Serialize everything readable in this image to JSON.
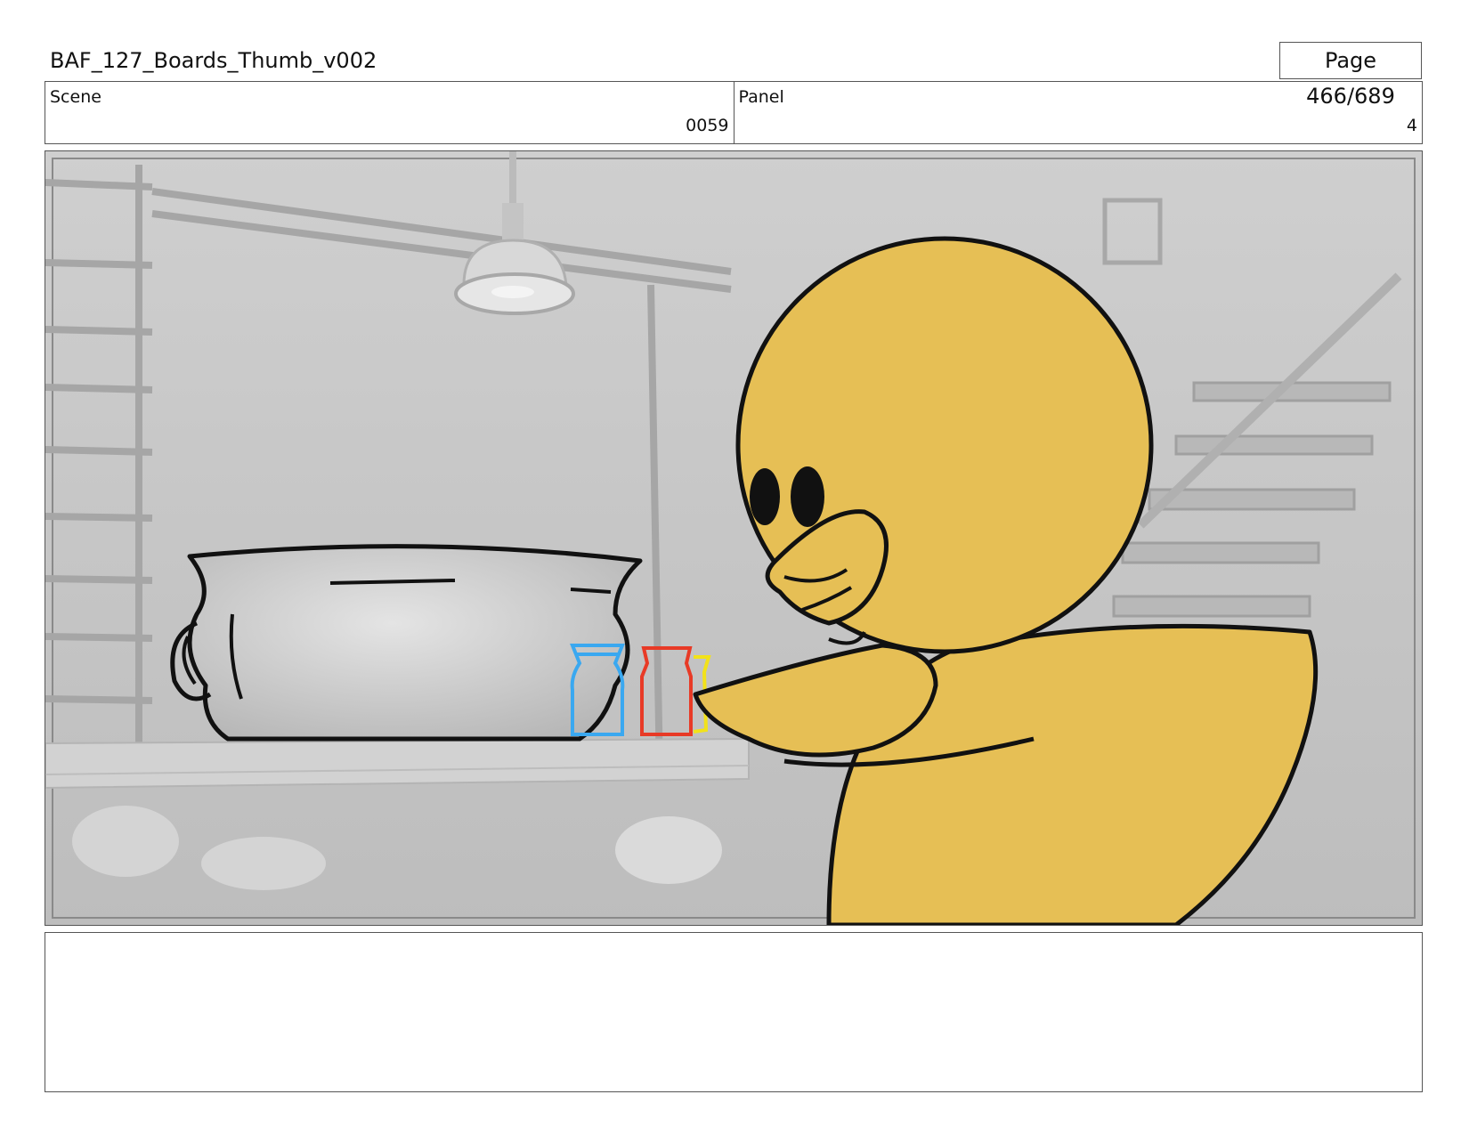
{
  "header": {
    "title": "BAF_127_Boards_Thumb_v002",
    "page": "Page 466/689"
  },
  "info": {
    "scene_label": "Scene",
    "scene_value": "0059",
    "panel_label": "Panel",
    "panel_value": "4"
  },
  "panel_image": {
    "icons": [
      "cooking-pot-icon",
      "blue-jar-icon",
      "red-jar-icon",
      "yellow-jar-icon",
      "duck-character-icon",
      "pendant-lamp-icon",
      "staircase-icon"
    ],
    "colors": {
      "background": "#c8c8c8",
      "duck": "#e6bf55",
      "jar_blue": "#3aa8f0",
      "jar_red": "#e83a26",
      "jar_yellow": "#f2e21a"
    }
  },
  "notes": {
    "text": ""
  }
}
